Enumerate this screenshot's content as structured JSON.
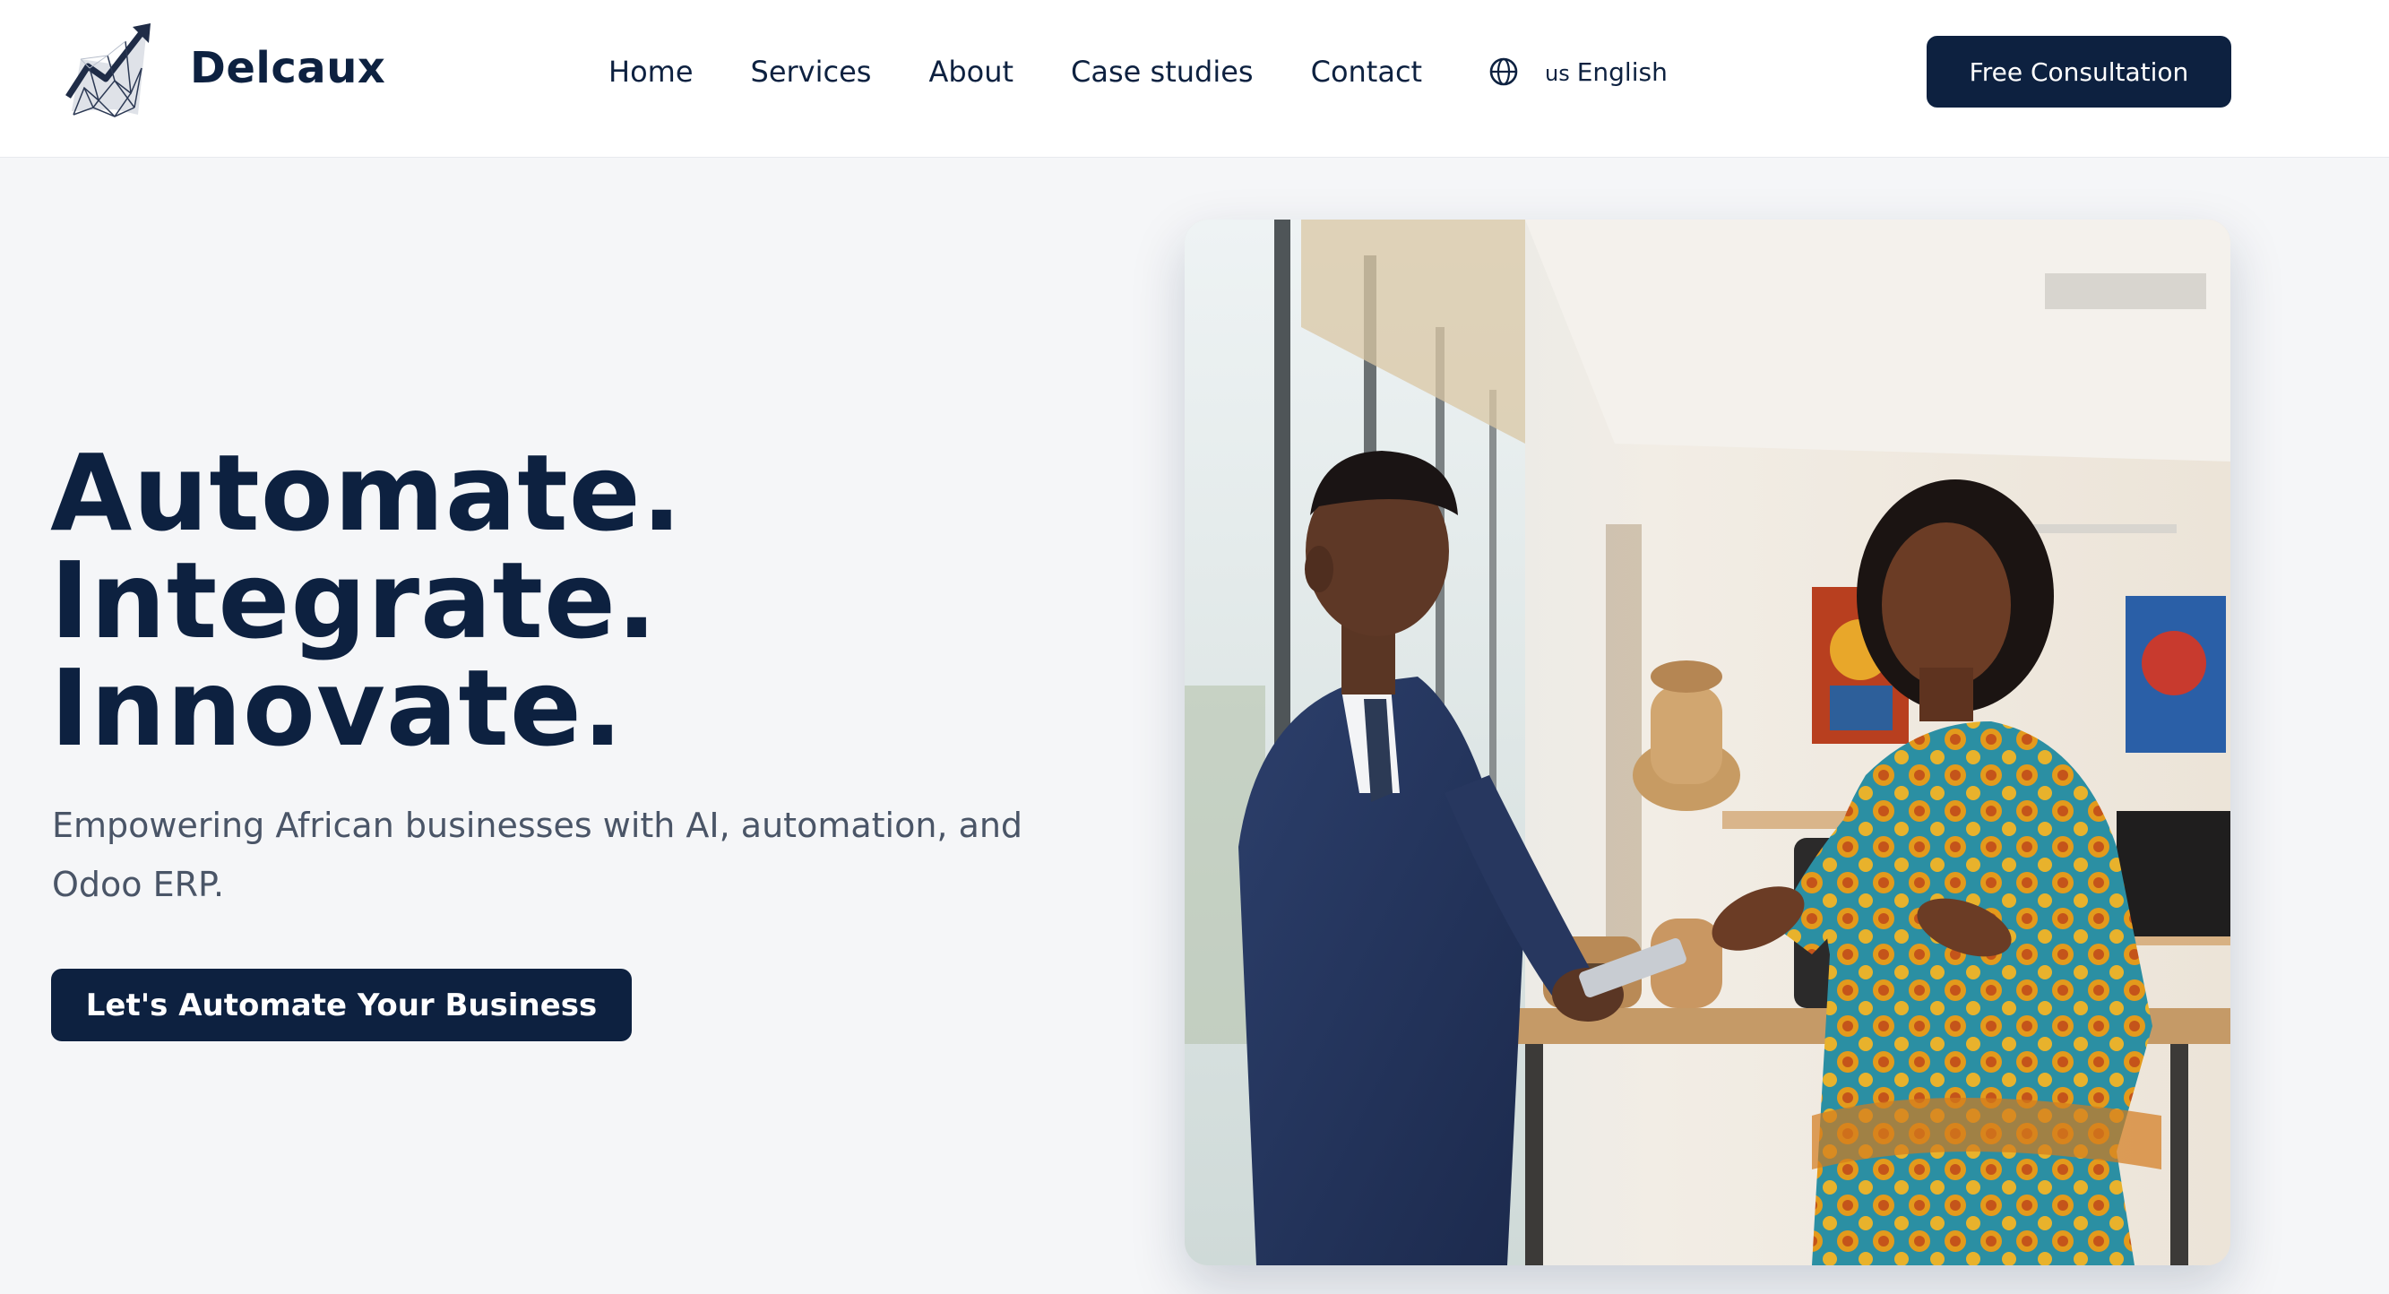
{
  "brand": {
    "name": "Delcaux"
  },
  "nav": {
    "items": [
      {
        "label": "Home"
      },
      {
        "label": "Services"
      },
      {
        "label": "About"
      },
      {
        "label": "Case studies"
      },
      {
        "label": "Contact"
      }
    ]
  },
  "language": {
    "code": "us",
    "label": "English",
    "icon": "globe-icon"
  },
  "header_cta": {
    "label": "Free Consultation"
  },
  "hero": {
    "title_lines": [
      "Automate.",
      "Integrate.",
      "Innovate."
    ],
    "subtitle": "Empowering African businesses with AI, automation, and Odoo ERP.",
    "cta_label": "Let's Automate Your Business"
  },
  "colors": {
    "primary": "#0d2140",
    "background": "#f5f6f8",
    "text_muted": "#4a5567"
  }
}
